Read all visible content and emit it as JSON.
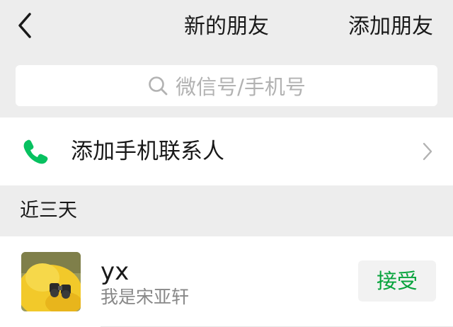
{
  "nav": {
    "title": "新的朋友",
    "add_friend_label": "添加朋友",
    "back_icon": "chevron-left-icon"
  },
  "search": {
    "placeholder": "微信号/手机号",
    "icon": "search-icon"
  },
  "add_phone_contacts": {
    "label": "添加手机联系人",
    "icon": "phone-icon",
    "icon_color": "#07c160"
  },
  "sections": [
    {
      "header": "近三天",
      "requests": [
        {
          "name": "yx",
          "message": "我是宋亚轩",
          "action_label": "接受",
          "avatar_icon": "yellow-duck-avatar"
        }
      ]
    }
  ],
  "colors": {
    "background": "#ededed",
    "accent_green": "#07a33c"
  }
}
